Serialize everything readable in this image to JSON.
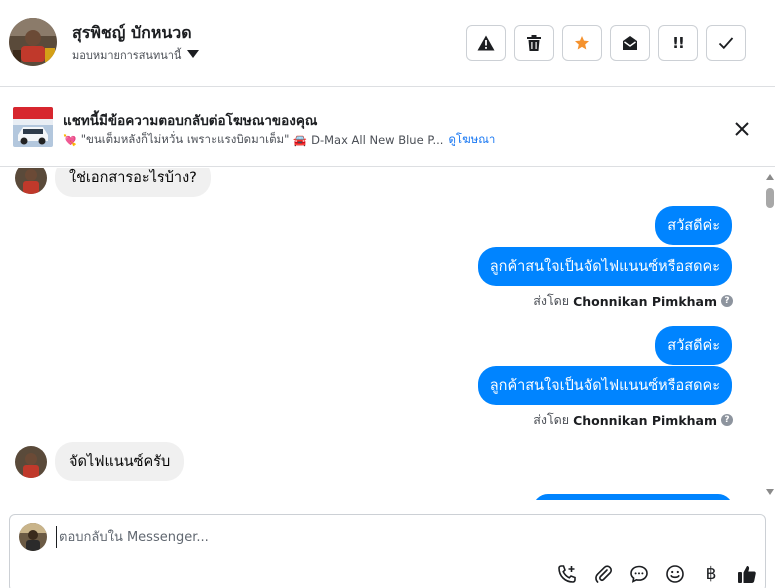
{
  "header": {
    "contact_name": "สุรพิชญ์ บักหนวด",
    "assign_label": "มอบหมายการสนทนานี้",
    "toolbar": [
      {
        "name": "report-spam-button",
        "icon": "warning-icon"
      },
      {
        "name": "delete-button",
        "icon": "trash-icon"
      },
      {
        "name": "star-button",
        "icon": "star-icon",
        "active_color": "#f5922e"
      },
      {
        "name": "mark-unread-button",
        "icon": "open-envelope-icon"
      },
      {
        "name": "follow-up-button",
        "icon": "follow-up-icon",
        "text": "!!"
      },
      {
        "name": "mark-done-button",
        "icon": "check-icon"
      }
    ]
  },
  "ad_banner": {
    "title": "แชทนี้มีข้อความตอบกลับต่อโฆษณาของคุณ",
    "emoji_heart": "💘",
    "quote": "\"ขนเต็มหลังก็ไม่หวั่น เพราะแรงบิดมาเต็ม\"",
    "emoji_car": "🚘",
    "ad_name": "D-Max All New Blue P...",
    "link": "ดูโฆษณา"
  },
  "messages": {
    "incoming_top": "ใช่เอกสารอะไรบ้าง?",
    "out_greeting_1": "สวัสดีค่ะ",
    "out_question_1": "ลูกค้าสนใจเป็นจัดไฟแนนซ์หรือสดคะ",
    "sent_by_prefix_1": "ส่งโดย",
    "sent_by_name_1": "Chonnikan Pimkham",
    "out_greeting_2": "สวัสดีค่ะ",
    "out_question_2": "ลูกค้าสนใจเป็นจัดไฟแนนซ์หรือสดคะ",
    "sent_by_prefix_2": "ส่งโดย",
    "sent_by_name_2": "Chonnikan Pimkham",
    "incoming_reply": "จัดไฟแนนซ์ครับ",
    "help_mark": "?"
  },
  "composer": {
    "placeholder": "ตอบกลับใน Messenger...",
    "baht_symbol": "฿"
  },
  "colors": {
    "accent": "#0084ff",
    "incoming_bubble": "#f0f0f0",
    "link": "#1877f2",
    "star": "#f5922e"
  }
}
